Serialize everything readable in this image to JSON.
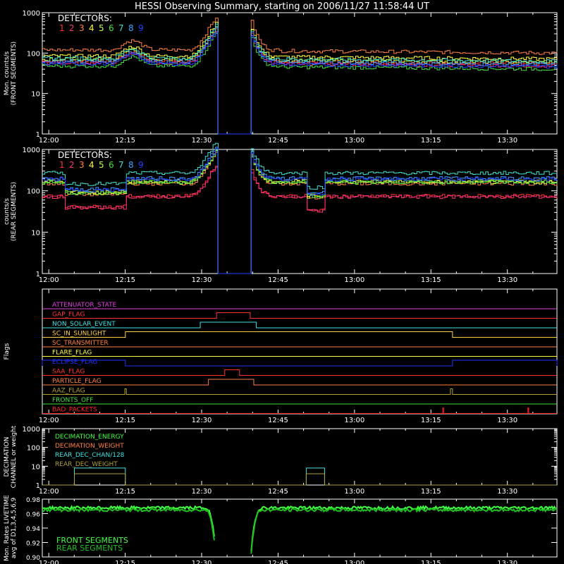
{
  "page": {
    "title": "HESSI Observing Summary, starting on 2006/11/27 11:58:44 UT"
  },
  "time_axis": {
    "start_min": 0,
    "end_min": 101,
    "ticks": [
      {
        "t": 1.27,
        "label": "12:00"
      },
      {
        "t": 16.27,
        "label": "12:15"
      },
      {
        "t": 31.27,
        "label": "12:30"
      },
      {
        "t": 46.27,
        "label": "12:45"
      },
      {
        "t": 61.27,
        "label": "13:00"
      },
      {
        "t": 76.27,
        "label": "13:15"
      },
      {
        "t": 91.27,
        "label": "13:30"
      }
    ]
  },
  "colors": {
    "det1": "#ff3030",
    "det2": "#ff3080",
    "det3": "#ff8040",
    "det4": "#ffff40",
    "det5": "#c0ff40",
    "det6": "#40e040",
    "det7": "#40e0d0",
    "det8": "#40a0ff",
    "det9": "#2040ff",
    "attenuator": "#e040e0",
    "gap": "#ff3030",
    "non_solar": "#40e0e0",
    "sunlight": "#ffd040",
    "transmitter": "#ff8040",
    "flare": "#ffff40",
    "eclipse": "#2030ff",
    "saa": "#ff3030",
    "particle": "#ff8040",
    "aaz": "#b0a030",
    "fronts_off": "#40e040",
    "bad_packets": "#ff2020",
    "dec_energy": "#40ff40",
    "dec_weight": "#ff8040",
    "rear_dec_chan": "#40e0e0",
    "rear_dec_weight": "#b0a030",
    "front_live": "#40ff40",
    "rear_live": "#20c020"
  },
  "chart_data": [
    {
      "type": "line",
      "name": "front",
      "ylabel": "Mon. counts/s\n(FRONT SEGMENTS)",
      "yscale": "log",
      "ylim": [
        1,
        1000
      ],
      "yticks": [
        "1",
        "10",
        "100",
        "1000"
      ],
      "legend_title": "DETECTORS:",
      "legend_labels": [
        "1",
        "2",
        "3",
        "4",
        "5",
        "6",
        "7",
        "8",
        "9"
      ],
      "outage": [
        34.2,
        40.8
      ],
      "series": [
        {
          "key": "det1",
          "level": 65
        },
        {
          "key": "det2",
          "level": 58
        },
        {
          "key": "det3",
          "level": 120
        },
        {
          "key": "det4",
          "level": 85
        },
        {
          "key": "det5",
          "level": 70
        },
        {
          "key": "det6",
          "level": 48
        },
        {
          "key": "det7",
          "level": 75
        },
        {
          "key": "det8",
          "level": 62
        },
        {
          "key": "det9",
          "level": 55
        }
      ]
    },
    {
      "type": "line",
      "name": "rear",
      "ylabel": "counts/s\n(REAR SEGMENTS)",
      "yscale": "log",
      "ylim": [
        1,
        1000
      ],
      "yticks": [
        "1",
        "10",
        "100",
        "1000"
      ],
      "legend_title": "DETECTORS:",
      "legend_labels": [
        "1",
        "2",
        "3",
        "4",
        "5",
        "6",
        "7",
        "8",
        "9"
      ],
      "outage": [
        34.2,
        40.8
      ],
      "series": [
        {
          "key": "det1",
          "level": 75
        },
        {
          "key": "det2",
          "level": 72
        },
        {
          "key": "det3",
          "level": 150
        },
        {
          "key": "det4",
          "level": 170
        },
        {
          "key": "det5",
          "level": 160
        },
        {
          "key": "det6",
          "level": 165
        },
        {
          "key": "det7",
          "level": 270
        },
        {
          "key": "det8",
          "level": 200
        },
        {
          "key": "det9",
          "level": 190
        }
      ]
    },
    {
      "type": "line",
      "name": "flags",
      "ylabel": "Flags",
      "flags": [
        {
          "label": "ATTENUATOR_STATE",
          "color": "attenuator",
          "segments": []
        },
        {
          "label": "GAP_FLAG",
          "color": "gap",
          "segments": [
            [
              34.2,
              40.8
            ]
          ]
        },
        {
          "label": "NON_SOLAR_EVENT",
          "color": "non_solar",
          "segments": [
            [
              31.0,
              42.0
            ]
          ]
        },
        {
          "label": "SC_IN_SUNLIGHT",
          "color": "sunlight",
          "segments": [
            [
              16.3,
              80.5
            ]
          ]
        },
        {
          "label": "SC_TRANSMITTER",
          "color": "transmitter",
          "segments": []
        },
        {
          "label": "FLARE_FLAG",
          "color": "flare",
          "segments": []
        },
        {
          "label": "ECLIPSE_FLAG",
          "color": "eclipse",
          "segments": [
            [
              0,
              16.3
            ],
            [
              80.5,
              101
            ]
          ]
        },
        {
          "label": "SAA_FLAG",
          "color": "saa",
          "segments": [
            [
              35.8,
              38.7
            ]
          ]
        },
        {
          "label": "PARTICLE_FLAG",
          "color": "particle",
          "segments": [
            [
              32.6,
              41.5
            ]
          ]
        },
        {
          "label": "AAZ_FLAG",
          "color": "aaz",
          "segments": [
            [
              16.2,
              16.5
            ],
            [
              80.1,
              80.5
            ]
          ]
        },
        {
          "label": "FRONTS_OFF",
          "color": "fronts_off",
          "segments": []
        },
        {
          "label": "BAD_PACKETS",
          "color": "bad_packets",
          "segments": [
            [
              78.6,
              78.75
            ],
            [
              95.3,
              95.45
            ]
          ]
        }
      ]
    },
    {
      "type": "line",
      "name": "decimation",
      "ylabel": "DECIMATION\nCHANNEL or weight",
      "yscale": "log",
      "ylim": [
        1,
        1000
      ],
      "yticks": [
        "1",
        "10",
        "100",
        "1000"
      ],
      "legend_entries": [
        {
          "label": "DECIMATION_ENERGY",
          "color": "dec_energy"
        },
        {
          "label": "DECIMATION_WEIGHT",
          "color": "dec_weight"
        },
        {
          "label": "REAR_DEC_CHAN/128",
          "color": "rear_dec_chan"
        },
        {
          "label": "REAR_DEC_WEIGHT",
          "color": "rear_dec_weight"
        }
      ],
      "steps": [
        {
          "key": "rear_dec_chan",
          "base": 1,
          "segments": [
            [
              6.3,
              16.3,
              8
            ],
            [
              51.8,
              55.4,
              8
            ]
          ]
        },
        {
          "key": "rear_dec_weight",
          "base": 1,
          "segments": [
            [
              6.3,
              16.3,
              4
            ],
            [
              51.8,
              55.4,
              4
            ]
          ]
        }
      ]
    },
    {
      "type": "line",
      "name": "livetime",
      "ylabel": "Mon. Rates LIVETIME\navg of D1,3,4,5,6,9",
      "ylim": [
        0.9,
        0.98
      ],
      "yticks": [
        "0.90",
        "0.92",
        "0.94",
        "0.96",
        "0.98"
      ],
      "legend_entries": [
        {
          "label": "FRONT SEGMENTS",
          "color": "front_live"
        },
        {
          "label": "REAR SEGMENTS",
          "color": "rear_live"
        }
      ],
      "series": [
        {
          "key": "front_live",
          "level": 0.968
        },
        {
          "key": "rear_live",
          "level": 0.965
        }
      ],
      "outage": [
        34.2,
        40.8
      ]
    }
  ]
}
